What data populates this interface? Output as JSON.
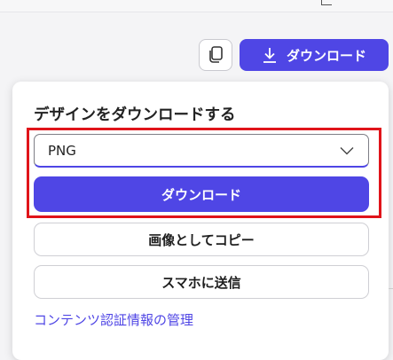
{
  "toolbar": {
    "download_label": "ダウンロード",
    "copy_icon": "copy-icon",
    "download_icon": "download-arrow-icon"
  },
  "panel": {
    "title": "デザインをダウンロードする",
    "format_select": {
      "value": "PNG",
      "icon": "chevron-down-icon"
    },
    "download_button": "ダウンロード",
    "copy_as_image_button": "画像としてコピー",
    "send_to_phone_button": "スマホに送信",
    "credentials_link": "コンテンツ認証情報の管理"
  },
  "colors": {
    "accent": "#4f46e5",
    "highlight": "#e0141a"
  }
}
